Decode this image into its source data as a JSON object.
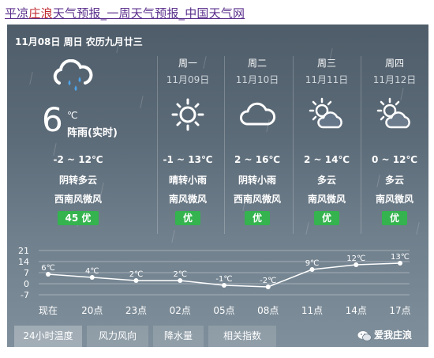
{
  "title": {
    "part1": "平凉",
    "part2": "庄浪",
    "part3": "天气预报_一周天气预报_中国天气网"
  },
  "header": {
    "date_line": "11月08日 周日 农历九月廿三"
  },
  "today": {
    "icon": "cloud-rain-icon",
    "temp": "6",
    "unit": "℃",
    "desc": "阵雨(实时)",
    "range": "-2 ~ 12℃",
    "cond": "阴转多云",
    "wind": "西南风微风",
    "aqi": "45 优"
  },
  "days": [
    {
      "name": "周一",
      "date": "11月09日",
      "icon": "sun-icon",
      "range": "-1 ~ 13℃",
      "cond": "晴转小雨",
      "wind": "南风微风",
      "aqi": "优"
    },
    {
      "name": "周二",
      "date": "11月10日",
      "icon": "cloud-icon",
      "range": "2 ~ 16℃",
      "cond": "阴转小雨",
      "wind": "西南风微风",
      "aqi": "优"
    },
    {
      "name": "周三",
      "date": "11月11日",
      "icon": "partly-cloudy-icon",
      "range": "2 ~ 14℃",
      "cond": "多云",
      "wind": "南风微风",
      "aqi": "优"
    },
    {
      "name": "周四",
      "date": "11月12日",
      "icon": "partly-cloudy-icon",
      "range": "0 ~ 12℃",
      "cond": "多云",
      "wind": "南风微风",
      "aqi": "优"
    }
  ],
  "chart_data": {
    "type": "line",
    "categories": [
      "现在",
      "20点",
      "23点",
      "02点",
      "05点",
      "08点",
      "11点",
      "14点",
      "17点"
    ],
    "values": [
      6,
      4,
      2,
      2,
      -1,
      -2,
      9,
      12,
      13
    ],
    "labels": [
      "6℃",
      "4℃",
      "2℃",
      "2℃",
      "-1℃",
      "-2℃",
      "9℃",
      "12℃",
      "13℃"
    ],
    "yticks": [
      "21",
      "14",
      "7",
      "0",
      "-7"
    ],
    "ylim": [
      -7,
      21
    ],
    "grid": true
  },
  "tabs": [
    "24小时温度",
    "风力风向",
    "降水量",
    "相关指数"
  ],
  "brand": "爱我庄浪",
  "colors": {
    "aqi_green": "#34b34e",
    "title_purple": "#5a2f8c",
    "title_red": "#c0282f"
  }
}
